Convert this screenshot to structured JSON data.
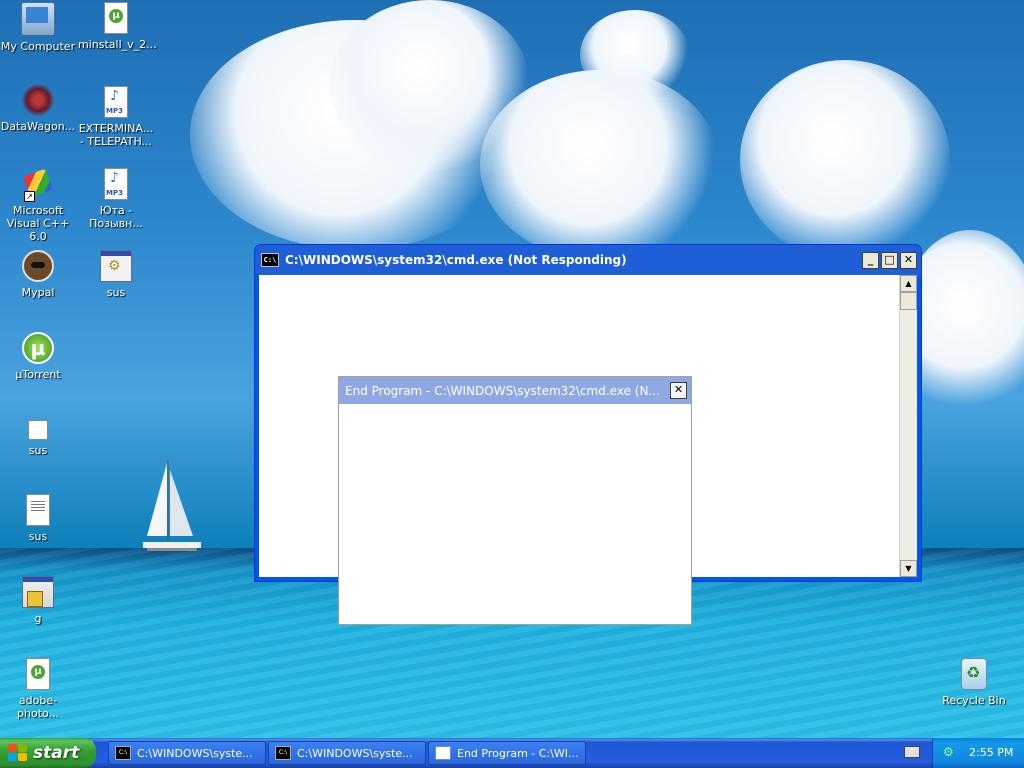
{
  "desktop": {
    "icons": [
      {
        "label": "My Computer",
        "icon": "my-computer-icon"
      },
      {
        "label": "minstall_v_2...",
        "icon": "utorrent-document-icon"
      },
      {
        "label": "DataWagon...",
        "icon": "datawagon-icon"
      },
      {
        "label": "EXTERMINA... - TELEPATH...",
        "icon": "mp3-file-icon"
      },
      {
        "label": "Microsoft Visual C++ 6.0",
        "icon": "visual-cpp-icon"
      },
      {
        "label": "Юта - Позывн...",
        "icon": "mp3-file-icon"
      },
      {
        "label": "Mypal",
        "icon": "mypal-browser-icon"
      },
      {
        "label": "sus",
        "icon": "executable-icon"
      },
      {
        "label": "µTorrent",
        "icon": "utorrent-icon"
      },
      {
        "label": "sus",
        "icon": "blank-file-icon"
      },
      {
        "label": "sus",
        "icon": "text-file-icon"
      },
      {
        "label": "g",
        "icon": "setup-program-icon"
      },
      {
        "label": "adobe-photo...",
        "icon": "utorrent-document-icon"
      },
      {
        "label": "Recycle Bin",
        "icon": "recycle-bin-icon"
      }
    ]
  },
  "cmd_window": {
    "title": "C:\\WINDOWS\\system32\\cmd.exe (Not Responding)",
    "icon_text": "C:\\",
    "minimize_label": "_",
    "maximize_label": "□",
    "close_label": "✕"
  },
  "end_program_dialog": {
    "title": "End Program - C:\\WINDOWS\\system32\\cmd.exe (N...",
    "close_label": "✕"
  },
  "taskbar": {
    "start_label": "start",
    "tasks": [
      {
        "label": "C:\\WINDOWS\\syste..."
      },
      {
        "label": "C:\\WINDOWS\\syste..."
      },
      {
        "label": "End Program - C:\\WI..."
      }
    ],
    "clock": "2:55 PM"
  },
  "colors": {
    "xp_blue": "#0058e6",
    "start_green": "#36a136",
    "inactive_title": "#8fa8e4"
  }
}
